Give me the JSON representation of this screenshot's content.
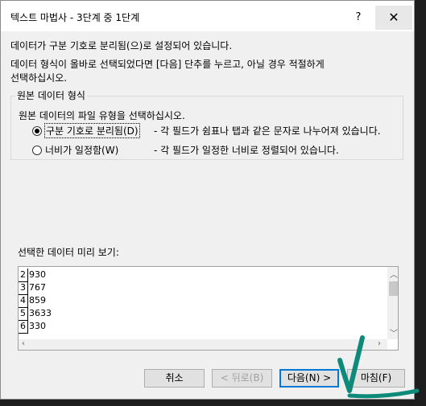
{
  "window": {
    "title": "텍스트 마법사 - 3단계 중 1단계",
    "help_label": "?",
    "close_label": "✕"
  },
  "intro": {
    "line1": "데이터가 구분 기호로 분리됨(으)로 설정되어 있습니다.",
    "line2": "데이터 형식이 올바로 선택되었다면 [다음] 단추를 누르고, 아닐 경우 적절하게",
    "line3": "선택하십시오."
  },
  "source_group": {
    "legend": "원본 데이터 형식",
    "prompt": "원본 데이터의 파일 유형을 선택하십시오.",
    "options": [
      {
        "label": "구분 기호로 분리됨(D)",
        "description": "- 각 필드가 쉼표나 탭과 같은 문자로 나누어져 있습니다.",
        "selected": true
      },
      {
        "label": "너비가 일정함(W)",
        "description": "- 각 필드가 일정한 너비로 정렬되어 있습니다.",
        "selected": false
      }
    ]
  },
  "preview": {
    "label": "선택한 데이터 미리 보기:",
    "rows": [
      {
        "num": "2",
        "value": "930"
      },
      {
        "num": "3",
        "value": "767"
      },
      {
        "num": "4",
        "value": "859"
      },
      {
        "num": "5",
        "value": "3633"
      },
      {
        "num": "6",
        "value": "330"
      }
    ]
  },
  "buttons": {
    "cancel": "취소",
    "back": "< 뒤로(B)",
    "next": "다음(N) >",
    "finish": "마침(F)"
  },
  "colors": {
    "annotation": "#0e8a7a",
    "default_button_border": "#0078d7"
  }
}
